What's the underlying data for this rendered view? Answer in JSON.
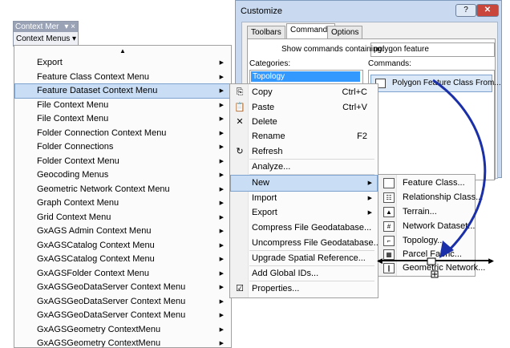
{
  "toolbar": {
    "title": "Context Mer",
    "close": "▾ ×",
    "dropdown": "Context Menus ▾"
  },
  "context_menu": {
    "items": [
      {
        "label": "Export"
      },
      {
        "label": "Feature Class Context Menu"
      },
      {
        "label": "Feature Dataset Context Menu"
      },
      {
        "label": "File Context Menu"
      },
      {
        "label": "File Context Menu"
      },
      {
        "label": "Folder Connection Context Menu"
      },
      {
        "label": "Folder Connections"
      },
      {
        "label": "Folder Context Menu"
      },
      {
        "label": "Geocoding Menus"
      },
      {
        "label": "Geometric Network Context Menu"
      },
      {
        "label": "Graph Context Menu"
      },
      {
        "label": "Grid Context Menu"
      },
      {
        "label": "GxAGS Admin Context Menu"
      },
      {
        "label": "GxAGSCatalog Context Menu"
      },
      {
        "label": "GxAGSCatalog Context Menu"
      },
      {
        "label": "GxAGSFolder Context Menu"
      },
      {
        "label": "GxAGSGeoDataServer Context Menu"
      },
      {
        "label": "GxAGSGeoDataServer Context Menu"
      },
      {
        "label": "GxAGSGeoDataServer Context Menu"
      },
      {
        "label": "GxAGSGeometry ContextMenu"
      },
      {
        "label": "GxAGSGeometry ContextMenu"
      }
    ]
  },
  "submenu": {
    "items": [
      {
        "label": "Copy",
        "shortcut": "Ctrl+C",
        "icon": "copy-icon",
        "glyph": "⎘"
      },
      {
        "label": "Paste",
        "shortcut": "Ctrl+V",
        "icon": "paste-icon",
        "glyph": "📋"
      },
      {
        "label": "Delete",
        "shortcut": "",
        "icon": "delete-icon",
        "glyph": "✕"
      },
      {
        "label": "Rename",
        "shortcut": "F2",
        "icon": "",
        "glyph": ""
      },
      {
        "label": "Refresh",
        "shortcut": "",
        "icon": "refresh-icon",
        "glyph": "↻"
      },
      {
        "label": "Analyze...",
        "shortcut": "",
        "icon": "",
        "glyph": ""
      },
      {
        "label": "New",
        "shortcut": "",
        "icon": "",
        "glyph": ""
      },
      {
        "label": "Import",
        "shortcut": "",
        "icon": "",
        "glyph": ""
      },
      {
        "label": "Export",
        "shortcut": "",
        "icon": "",
        "glyph": ""
      },
      {
        "label": "Compress File Geodatabase...",
        "shortcut": "",
        "icon": "",
        "glyph": ""
      },
      {
        "label": "Uncompress File Geodatabase...",
        "shortcut": "",
        "icon": "",
        "glyph": ""
      },
      {
        "label": "Upgrade Spatial Reference...",
        "shortcut": "",
        "icon": "",
        "glyph": ""
      },
      {
        "label": "Add Global IDs...",
        "shortcut": "",
        "icon": "",
        "glyph": ""
      },
      {
        "label": "Properties...",
        "shortcut": "",
        "icon": "properties-icon",
        "glyph": "☑"
      }
    ]
  },
  "new_submenu": {
    "items": [
      {
        "label": "Feature Class...",
        "glyph": ""
      },
      {
        "label": "Relationship Class...",
        "glyph": "☷"
      },
      {
        "label": "Terrain...",
        "glyph": "▲"
      },
      {
        "label": "Network Dataset...",
        "glyph": "#"
      },
      {
        "label": "Topology...",
        "glyph": "⌐"
      },
      {
        "label": "Parcel Fabric...",
        "glyph": "▦"
      },
      {
        "label": "Geometric Network...",
        "glyph": "∥"
      }
    ]
  },
  "dialog": {
    "title": "Customize",
    "help": "?",
    "close": "✕",
    "tabs": [
      "Toolbars",
      "Commands",
      "Options"
    ],
    "show_commands_label": "Show commands containing:",
    "search_value": "polygon feature",
    "categories_label": "Categories:",
    "commands_label": "Commands:",
    "category_selected": "Topology",
    "command_selected": "Polygon Feature Class From..."
  }
}
